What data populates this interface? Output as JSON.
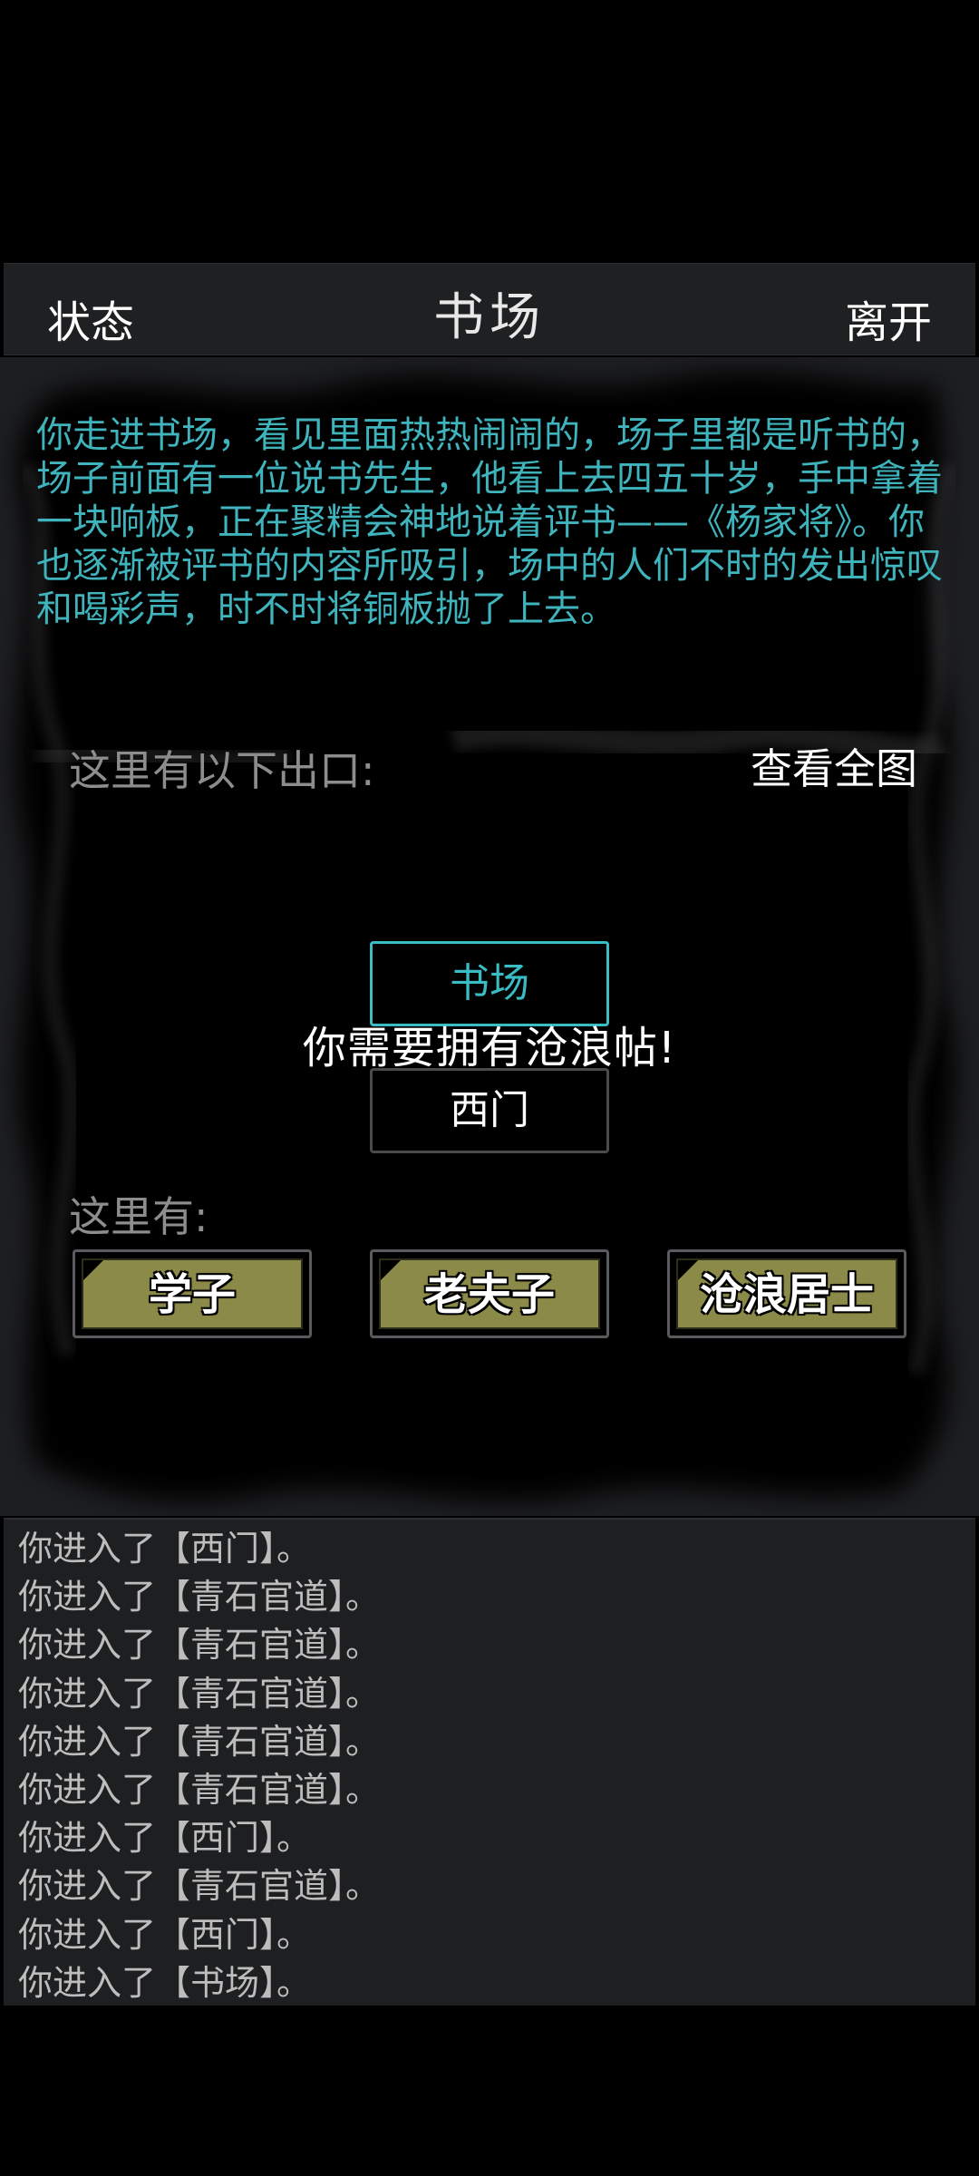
{
  "header": {
    "left_label": "状态",
    "title": "书场",
    "right_label": "离开"
  },
  "scene": {
    "description": "你走进书场，看见里面热热闹闹的，场子里都是听书的，场子前面有一位说书先生，他看上去四五十岁，手中拿着一块响板，正在聚精会神地说着评书——《杨家将》。你也逐渐被评书的内容所吸引，场中的人们不时的发出惊叹和喝彩声，时不时将铜板抛了上去。",
    "exits_label": "这里有以下出口:",
    "view_map_label": "查看全图",
    "exits": [
      {
        "label": "书场"
      },
      {
        "label": "西门"
      }
    ],
    "toast": "你需要拥有沧浪帖!",
    "here_label": "这里有:",
    "npcs": [
      {
        "label": "学子"
      },
      {
        "label": "老夫子"
      },
      {
        "label": "沧浪居士"
      }
    ]
  },
  "log": [
    "你进入了【西门】。",
    "你进入了【青石官道】。",
    "你进入了【青石官道】。",
    "你进入了【青石官道】。",
    "你进入了【青石官道】。",
    "你进入了【青石官道】。",
    "你进入了【西门】。",
    "你进入了【青石官道】。",
    "你进入了【西门】。",
    "你进入了【书场】。"
  ],
  "colors": {
    "description_text": "#3fb4bd",
    "current_exit": "#39bcc4",
    "npc_button_fill": "#8c8a48",
    "header_bg": "#1f2022",
    "log_bg": "#1e1f21"
  }
}
